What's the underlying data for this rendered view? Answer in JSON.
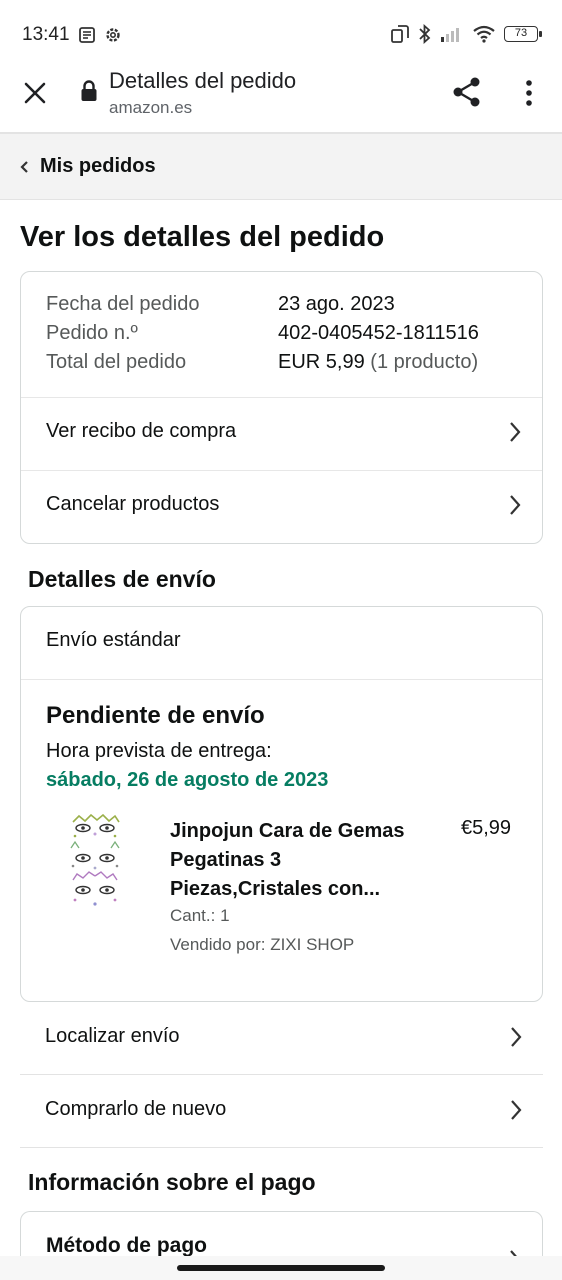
{
  "status_bar": {
    "time": "13:41",
    "battery": "73"
  },
  "browser": {
    "title": "Detalles del pedido",
    "url": "amazon.es"
  },
  "breadcrumb": {
    "label": "Mis pedidos"
  },
  "heading": "Ver los detalles del pedido",
  "summary": {
    "order_date_label": "Fecha del pedido",
    "order_date": "23 ago. 2023",
    "order_number_label": "Pedido n.º",
    "order_number": "402-0405452-1811516",
    "order_total_label": "Total del pedido",
    "order_total": "EUR 5,99",
    "order_items": "(1 producto)",
    "links": [
      {
        "label": "Ver recibo de compra"
      },
      {
        "label": "Cancelar productos"
      }
    ]
  },
  "shipping": {
    "section_title": "Detalles de envío",
    "method": "Envío estándar",
    "status": "Pendiente de envío",
    "eta_label": "Hora prevista de entrega:",
    "eta_date": "sábado, 26 de agosto de 2023",
    "eta_color": "#067d62",
    "product": {
      "title": "Jinpojun Cara de Gemas Pegatinas 3 Piezas,Cristales con...",
      "price": "€5,99",
      "qty": "Cant.: 1",
      "seller": "Vendido por: ZIXI SHOP"
    }
  },
  "actions": [
    {
      "label": "Localizar envío"
    },
    {
      "label": "Comprarlo de nuevo"
    }
  ],
  "payment": {
    "section_title": "Información sobre el pago",
    "method_title": "Método de pago"
  }
}
